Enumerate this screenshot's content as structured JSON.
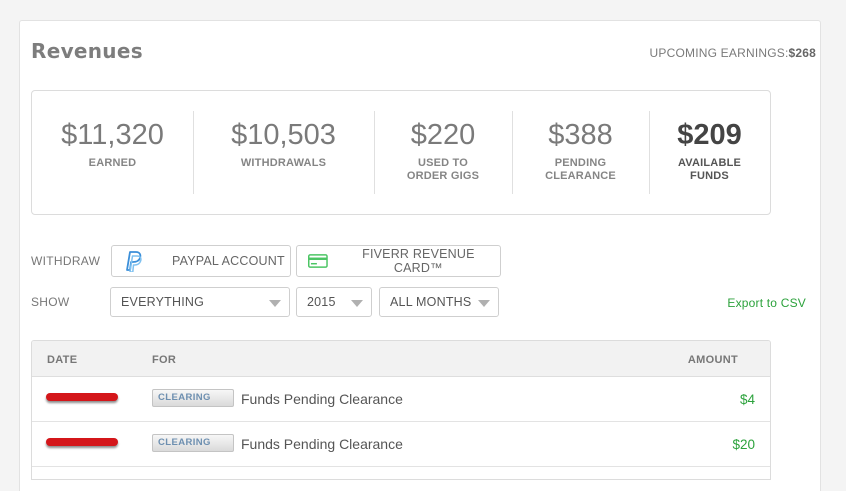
{
  "header": {
    "title": "Revenues",
    "upcoming_label": "UPCOMING EARNINGS:",
    "upcoming_value": "$268"
  },
  "stats": [
    {
      "value": "$11,320",
      "label": "EARNED"
    },
    {
      "value": "$10,503",
      "label": "WITHDRAWALS"
    },
    {
      "value": "$220",
      "label": "USED TO\nORDER GIGS"
    },
    {
      "value": "$388",
      "label": "PENDING\nCLEARANCE"
    },
    {
      "value": "$209",
      "label": "AVAILABLE\nFUNDS"
    }
  ],
  "withdraw": {
    "label": "WITHDRAW",
    "paypal": {
      "label": "PAYPAL ACCOUNT",
      "icon": "paypal-icon"
    },
    "revenue_card": {
      "label": "FIVERR REVENUE CARD™",
      "icon": "credit-card-icon"
    }
  },
  "filters": {
    "label": "SHOW",
    "type": "EVERYTHING",
    "year": "2015",
    "month": "ALL MONTHS",
    "export_label": "Export to CSV"
  },
  "table": {
    "columns": {
      "date": "DATE",
      "for": "FOR",
      "amount": "AMOUNT"
    },
    "rows": [
      {
        "status": "CLEARING",
        "description": "Funds Pending Clearance",
        "amount": "$4"
      },
      {
        "status": "CLEARING",
        "description": "Funds Pending Clearance",
        "amount": "$20"
      }
    ]
  },
  "colors": {
    "accent_green": "#2ca23c",
    "paypal_blue": "#3b8fd9",
    "card_green": "#4cc564",
    "redaction_red": "#d4161a"
  }
}
